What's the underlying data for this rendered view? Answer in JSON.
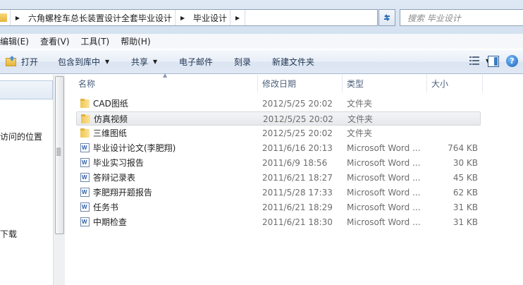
{
  "address": {
    "crumbs": [
      "六角螺栓车总长装置设计全套毕业设计",
      "毕业设计"
    ],
    "search_placeholder": "搜索 毕业设计"
  },
  "menu": [
    "编辑(E)",
    "查看(V)",
    "工具(T)",
    "帮助(H)"
  ],
  "toolbar": {
    "open": "打开",
    "include_library": "包含到库中",
    "share": "共享",
    "email": "电子邮件",
    "burn": "刻录",
    "new_folder": "新建文件夹"
  },
  "nav": {
    "items": [
      "访问的位置",
      "下载"
    ]
  },
  "columns": {
    "name": "名称",
    "date": "修改日期",
    "type": "类型",
    "size": "大小"
  },
  "files": [
    {
      "name": "CAD图纸",
      "date": "2012/5/25 20:02",
      "type": "文件夹",
      "size": "",
      "icon": "folder-icon",
      "selected": false
    },
    {
      "name": "仿真视频",
      "date": "2012/5/25 20:02",
      "type": "文件夹",
      "size": "",
      "icon": "folder-icon",
      "selected": true
    },
    {
      "name": "三维图纸",
      "date": "2012/5/25 20:02",
      "type": "文件夹",
      "size": "",
      "icon": "folder-icon",
      "selected": false
    },
    {
      "name": "毕业设计论文(李肥翔)",
      "date": "2011/6/16 20:13",
      "type": "Microsoft Word ...",
      "size": "764 KB",
      "icon": "word-document-icon",
      "selected": false
    },
    {
      "name": "毕业实习报告",
      "date": "2011/6/9 18:56",
      "type": "Microsoft Word ...",
      "size": "30 KB",
      "icon": "word-document-icon",
      "selected": false
    },
    {
      "name": "答辩记录表",
      "date": "2011/6/21 18:27",
      "type": "Microsoft Word ...",
      "size": "45 KB",
      "icon": "word-document-icon",
      "selected": false
    },
    {
      "name": "李肥翔开题报告",
      "date": "2011/5/28 17:33",
      "type": "Microsoft Word ...",
      "size": "62 KB",
      "icon": "word-document-icon",
      "selected": false
    },
    {
      "name": "任务书",
      "date": "2011/6/21 18:29",
      "type": "Microsoft Word ...",
      "size": "31 KB",
      "icon": "word-document-icon",
      "selected": false
    },
    {
      "name": "中期检查",
      "date": "2011/6/21 18:30",
      "type": "Microsoft Word ...",
      "size": "31 KB",
      "icon": "word-document-icon",
      "selected": false
    }
  ]
}
